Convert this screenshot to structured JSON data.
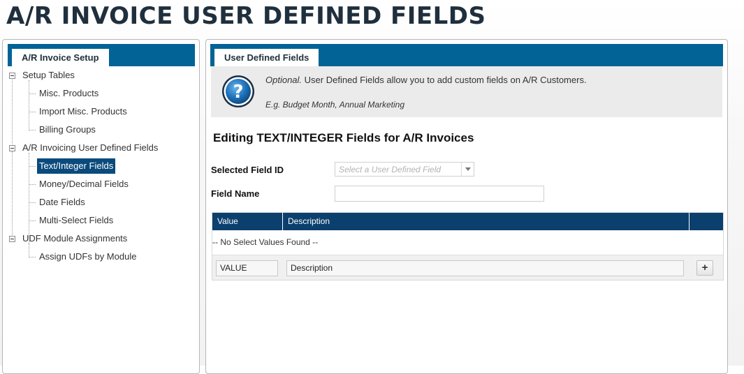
{
  "page": {
    "title": "A/R INVOICE USER DEFINED FIELDS"
  },
  "left_panel": {
    "tab_label": "A/R Invoice Setup",
    "tree": [
      {
        "label": "Setup Tables",
        "level": 0,
        "expanded": true
      },
      {
        "label": "Misc. Products",
        "level": 1
      },
      {
        "label": "Import Misc. Products",
        "level": 1
      },
      {
        "label": "Billing Groups",
        "level": 1
      },
      {
        "label": "A/R Invoicing User Defined Fields",
        "level": 0,
        "expanded": true
      },
      {
        "label": "Text/Integer Fields",
        "level": 1,
        "selected": true
      },
      {
        "label": "Money/Decimal Fields",
        "level": 1
      },
      {
        "label": "Date Fields",
        "level": 1
      },
      {
        "label": "Multi-Select Fields",
        "level": 1
      },
      {
        "label": "UDF Module Assignments",
        "level": 0,
        "expanded": true
      },
      {
        "label": "Assign UDFs by Module",
        "level": 1
      }
    ]
  },
  "right_panel": {
    "tab_label": "User Defined Fields",
    "info": {
      "optional_prefix": "Optional.",
      "message": " User Defined Fields allow you to add custom fields on A/R Customers.",
      "example": "E.g. Budget Month, Annual Marketing",
      "icon": "question-mark-icon"
    },
    "heading": "Editing TEXT/INTEGER Fields for A/R Invoices",
    "form": {
      "field_id_label": "Selected Field ID",
      "field_id_placeholder": "Select a User Defined Field",
      "field_name_label": "Field Name",
      "field_name_value": ""
    },
    "grid": {
      "columns": [
        "Value",
        "Description",
        ""
      ],
      "empty_message": "-- No Select Values Found --",
      "entry_value": "VALUE",
      "entry_description": "Description",
      "add_label": "+"
    }
  },
  "colors": {
    "tab_bar": "#016396",
    "grid_header": "#0b3f6e",
    "selected_node": "#0b4a7c",
    "title": "#1f2f3d"
  }
}
